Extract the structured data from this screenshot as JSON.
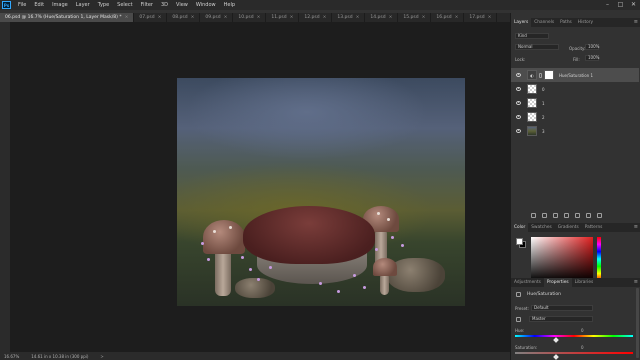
{
  "app": {
    "logo": "Ps"
  },
  "menu": [
    "File",
    "Edit",
    "Image",
    "Layer",
    "Type",
    "Select",
    "Filter",
    "3D",
    "View",
    "Window",
    "Help"
  ],
  "window_controls": [
    "–",
    "□",
    "✕"
  ],
  "tabs": [
    {
      "label": "06.psd @ 16.7% (Hue/Saturation 1, Layer Mask/8) *",
      "active": true
    },
    {
      "label": "07.psd",
      "active": false
    },
    {
      "label": "08.psd",
      "active": false
    },
    {
      "label": "09.psd",
      "active": false
    },
    {
      "label": "10.psd",
      "active": false
    },
    {
      "label": "11.psd",
      "active": false
    },
    {
      "label": "12.psd",
      "active": false
    },
    {
      "label": "13.psd",
      "active": false
    },
    {
      "label": "14.psd",
      "active": false
    },
    {
      "label": "15.psd",
      "active": false
    },
    {
      "label": "16.psd",
      "active": false
    },
    {
      "label": "17.psd",
      "active": false
    }
  ],
  "tab_close": "×",
  "status": {
    "zoom": "16.67%",
    "size": "14.61 in x 10.38 in (300 ppi)",
    "arrow": ">"
  },
  "layers_panel": {
    "tabs": [
      "Layers",
      "Channels",
      "Paths",
      "History"
    ],
    "menu_icon": "≡",
    "kind": "Kind",
    "blend_mode": "Normal",
    "opacity_label": "Opacity:",
    "opacity_value": "100%",
    "lock_label": "Lock:",
    "fill_label": "Fill:",
    "fill_value": "100%",
    "adjustment_glyph": "◐",
    "layers": [
      {
        "name": "Hue/Saturation 1",
        "type": "adjustment",
        "active": true
      },
      {
        "name": "0",
        "type": "checker",
        "active": false
      },
      {
        "name": "1",
        "type": "checker",
        "active": false
      },
      {
        "name": "2",
        "type": "checker",
        "active": false
      },
      {
        "name": "3",
        "type": "photo",
        "active": false
      }
    ]
  },
  "color_panel": {
    "tabs": [
      "Color",
      "Swatches",
      "Gradients",
      "Patterns"
    ],
    "foreground": "#ffffff",
    "background": "#000000"
  },
  "properties_panel": {
    "tabs": [
      "Adjustments",
      "Properties",
      "Libraries"
    ],
    "title": "Hue/Saturation",
    "preset_label": "Preset:",
    "preset_value": "Default",
    "channel_value": "Master",
    "hue_label": "Hue:",
    "hue_value": "0",
    "saturation_label": "Saturation:",
    "saturation_value": "0"
  }
}
